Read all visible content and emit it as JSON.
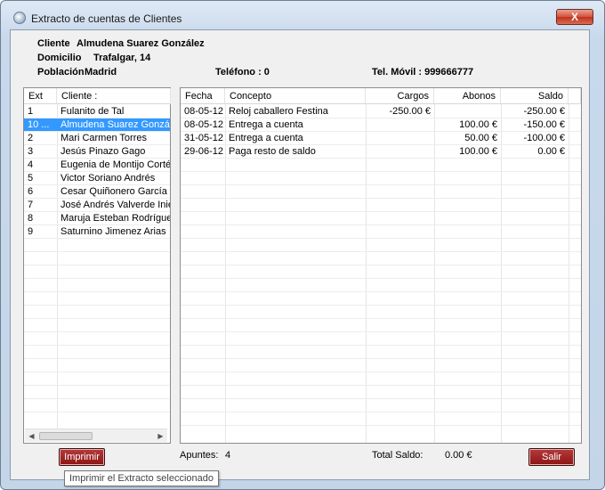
{
  "window": {
    "title": "Extracto de cuentas de Clientes",
    "close_label": "X"
  },
  "info": {
    "cliente_label": "Cliente",
    "cliente_value": "Almudena Suarez González",
    "domicilio_label": "Domicilio",
    "domicilio_value": "Trafalgar, 14",
    "poblacion_label": "Población",
    "poblacion_value": "Madrid",
    "telefono": "Teléfono : 0",
    "movil": "Tel. Móvil : 999666777"
  },
  "clients": {
    "headers": [
      "Ext",
      "Cliente :"
    ],
    "rows": [
      {
        "ext": "1",
        "name": "Fulanito de Tal"
      },
      {
        "ext": "10 ...",
        "name": "Almudena Suarez González"
      },
      {
        "ext": "2",
        "name": "Mari Carmen Torres"
      },
      {
        "ext": "3",
        "name": "Jesús Pinazo Gago"
      },
      {
        "ext": "4",
        "name": "Eugenia de Montijo Cortés"
      },
      {
        "ext": "5",
        "name": "Victor Soriano Andrés"
      },
      {
        "ext": "6",
        "name": "Cesar Quiñonero García"
      },
      {
        "ext": "7",
        "name": "José Andrés Valverde Iniesta"
      },
      {
        "ext": "8",
        "name": "Maruja Esteban Rodríguez"
      },
      {
        "ext": "9",
        "name": "Saturnino Jimenez Arias"
      }
    ],
    "selected_index": 1
  },
  "movements": {
    "headers": [
      "Fecha",
      "Concepto",
      "Cargos",
      "Abonos",
      "Saldo"
    ],
    "rows": [
      {
        "fecha": "08-05-12",
        "concepto": "Reloj caballero Festina",
        "cargos": "-250.00 €",
        "abonos": "",
        "saldo": "-250.00 €"
      },
      {
        "fecha": "08-05-12",
        "concepto": "Entrega a cuenta",
        "cargos": "",
        "abonos": "100.00 €",
        "saldo": "-150.00 €"
      },
      {
        "fecha": "31-05-12",
        "concepto": "Entrega a cuenta",
        "cargos": "",
        "abonos": "50.00 €",
        "saldo": "-100.00 €"
      },
      {
        "fecha": "29-06-12",
        "concepto": "Paga resto de saldo",
        "cargos": "",
        "abonos": "100.00 €",
        "saldo": "0.00 €"
      }
    ]
  },
  "footer": {
    "print_label": "Imprimir",
    "apuntes_label": "Apuntes:",
    "apuntes_value": "4",
    "total_label": "Total Saldo:",
    "total_value": "0.00 €",
    "exit_label": "Salir",
    "tooltip": "Imprimir el Extracto seleccionado"
  },
  "colors": {
    "selection": "#3399ff",
    "button_red": "#8d1414"
  }
}
